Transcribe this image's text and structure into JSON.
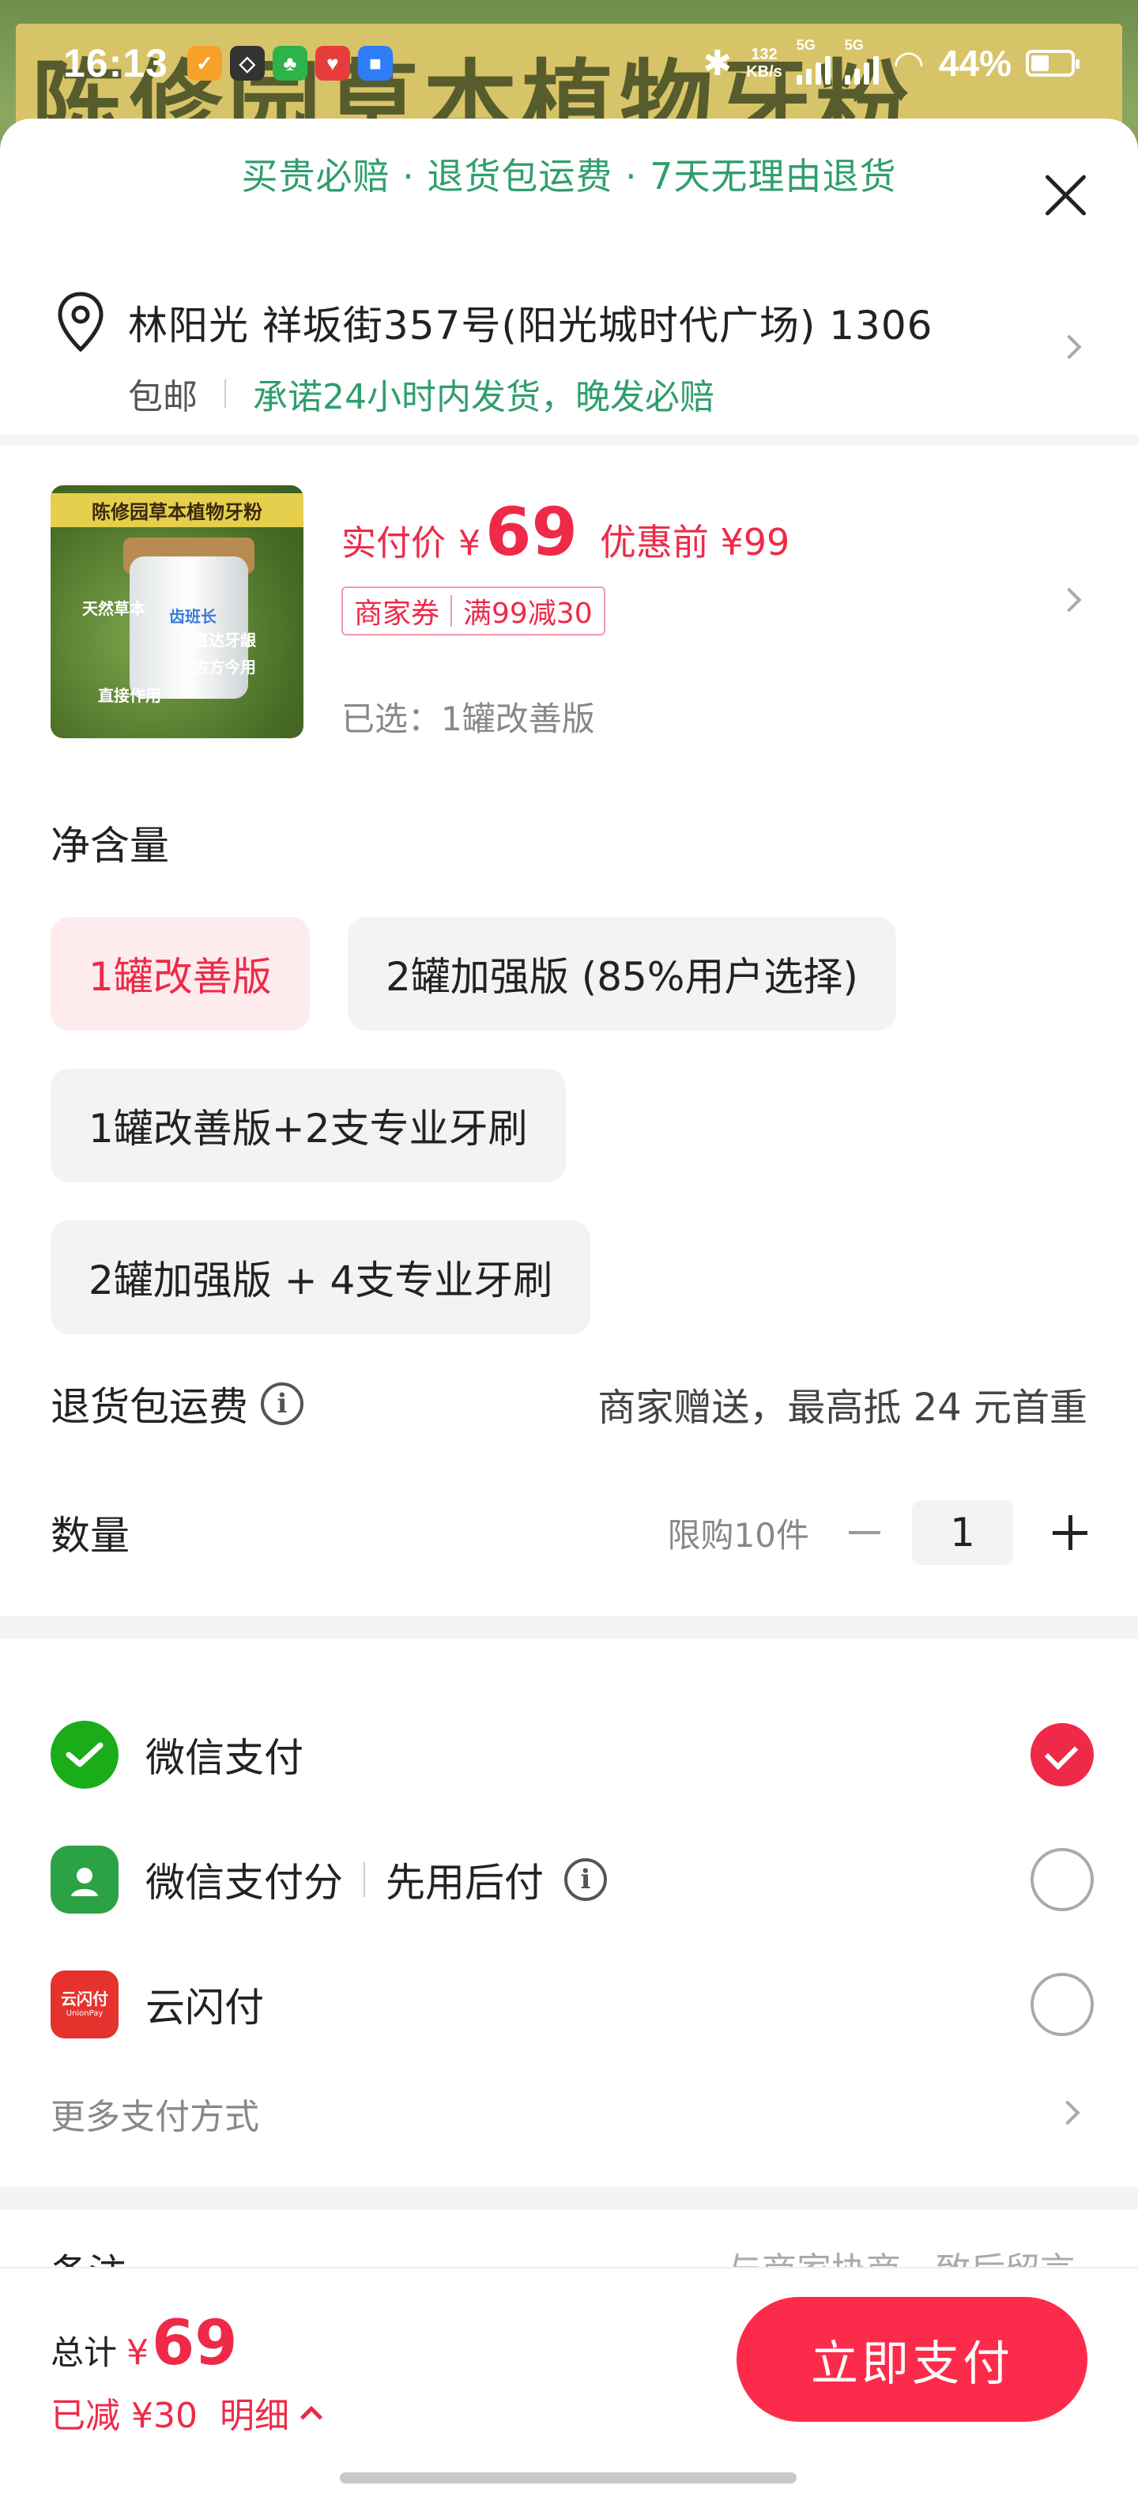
{
  "status_bar": {
    "time": "16:13",
    "net_speed_value": "132",
    "net_speed_unit": "KB/s",
    "signal_1": "5G",
    "signal_2": "5G",
    "battery": "44%"
  },
  "background_banner": "陈修园草本植物牙粉",
  "header": {
    "promise": "买贵必赔 · 退货包运费 · 7天无理由退货"
  },
  "address": {
    "line": "林阳光 祥坂街357号(阳光城时代广场) 1306",
    "shipping_free": "包邮",
    "shipping_promise": "承诺24小时内发货，晚发必赔"
  },
  "product": {
    "image_title": "陈修园草本植物牙粉",
    "image_tags": [
      "天然草本",
      "直达牙龈",
      "古方今用",
      "直接作用",
      "齿班长"
    ],
    "price_label": "实付价",
    "currency": "¥",
    "price": "69",
    "original_label": "优惠前 ¥99",
    "coupon_type": "商家券",
    "coupon_value": "满99减30",
    "selected": "已选：1罐改善版"
  },
  "spec": {
    "title": "净含量",
    "options": [
      {
        "label": "1罐改善版",
        "selected": true
      },
      {
        "label": "2罐加强版 (85%用户选择)",
        "selected": false
      },
      {
        "label": "1罐改善版+2支专业牙刷",
        "selected": false
      },
      {
        "label": "2罐加强版 + 4支专业牙刷",
        "selected": false
      }
    ]
  },
  "return_shipping": {
    "label": "退货包运费",
    "desc": "商家赠送，最高抵 24 元首重"
  },
  "quantity": {
    "label": "数量",
    "limit": "限购10件",
    "value": "1"
  },
  "payment": {
    "methods": [
      {
        "label": "微信支付",
        "extra": "",
        "checked": true
      },
      {
        "label": "微信支付分",
        "extra": "先用后付",
        "checked": false
      },
      {
        "label": "云闪付",
        "extra": "",
        "checked": false
      }
    ],
    "more": "更多支付方式",
    "unionpay_icon_text": "云闪付",
    "unionpay_icon_subtext": "UnionPay"
  },
  "remark": {
    "label": "备注",
    "hint": "与商家协商一致后留言"
  },
  "footer": {
    "total_label": "总计",
    "currency": "¥",
    "total": "69",
    "discount": "已减 ¥30",
    "detail": "明细",
    "pay_button": "立即支付"
  },
  "colors": {
    "accent_red": "#ee2a48",
    "accent_green": "#2f9e6e",
    "wechat_green": "#1aad19"
  }
}
